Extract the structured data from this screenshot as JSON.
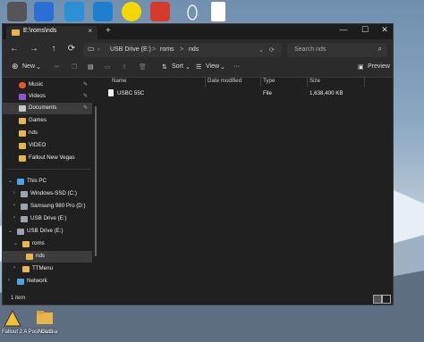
{
  "desktop": {
    "bottom_icons": [
      {
        "label": "Fallout 2 A Post Nuclea",
        "icon": "fallout-icon"
      },
      {
        "label": "ACUG",
        "icon": "folder-icon"
      }
    ]
  },
  "window": {
    "tab_title": "E:\\roms\\nds",
    "new_tab": "+",
    "controls": {
      "minimize": "—",
      "maximize": "☐",
      "close": "✕"
    },
    "nav": {
      "back": "←",
      "forward": "→",
      "up": "↑",
      "refresh": "⟳"
    },
    "address": {
      "crumbs": [
        "USB Drive (E:)",
        "roms",
        "nds"
      ],
      "separator": ">"
    },
    "search": {
      "placeholder": "Search nds"
    },
    "command_bar": {
      "new_label": "New",
      "sort_label": "Sort",
      "view_label": "View",
      "more": "···",
      "preview_label": "Preview"
    },
    "sidebar": {
      "items": [
        {
          "label": "Music",
          "pinned": true
        },
        {
          "label": "Videos",
          "pinned": true
        },
        {
          "label": "Documents",
          "pinned": true,
          "selected": true
        },
        {
          "label": "Games"
        },
        {
          "label": "nds"
        },
        {
          "label": "VIDEO"
        },
        {
          "label": "Fallout New Vegas"
        },
        {
          "label": "This PC"
        },
        {
          "label": "Windows-SSD (C:)"
        },
        {
          "label": "Samsung 980 Pro (D:)"
        },
        {
          "label": "USB Drive (E:)"
        },
        {
          "label": "USB Drive (E:)"
        },
        {
          "label": "roms"
        },
        {
          "label": "nds",
          "selected": true
        },
        {
          "label": "TTMenu"
        },
        {
          "label": "Network"
        }
      ]
    },
    "columns": {
      "name": "Name",
      "date": "Date modified",
      "type": "Type",
      "size": "Size"
    },
    "files": [
      {
        "name": "USBC 55C",
        "date": "",
        "type": "File",
        "size": "1,638,400 KB"
      }
    ],
    "status": {
      "count": "1 item"
    }
  }
}
